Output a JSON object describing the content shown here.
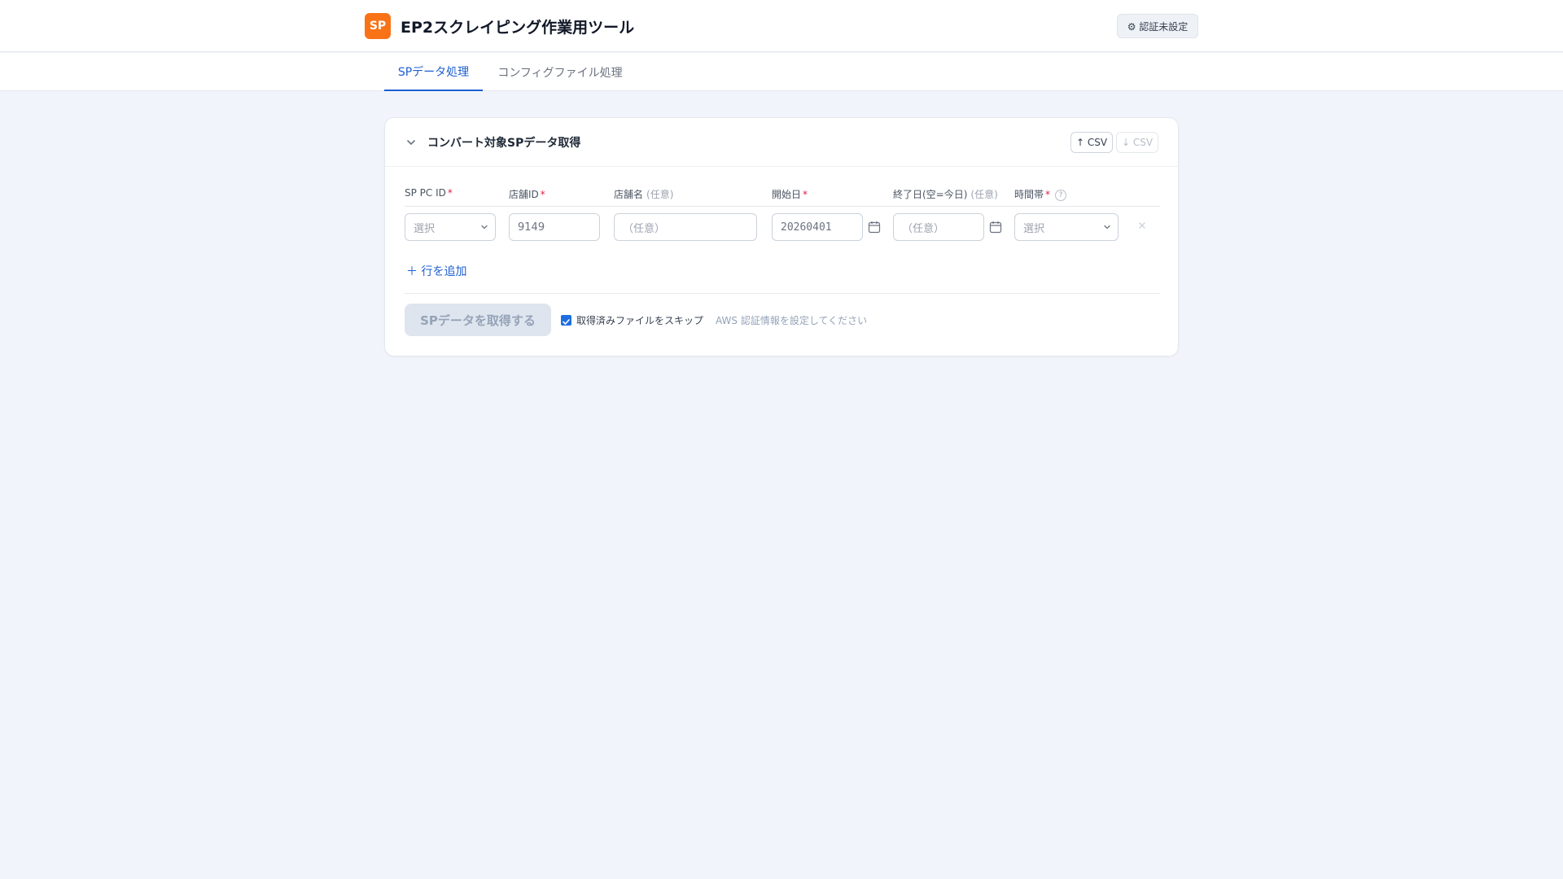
{
  "app": {
    "logo_text": "SP",
    "title": "EP2スクレイピング作業用ツール",
    "auth_button": "⚙ 認証未設定"
  },
  "tabs": [
    {
      "label": "SPデータ処理",
      "active": true
    },
    {
      "label": "コンフィグファイル処理",
      "active": false
    }
  ],
  "card": {
    "title": "コンバート対象SPデータ取得",
    "csv_upload": "↑ CSV",
    "csv_download": "↓ CSV",
    "columns": {
      "sp_pc_id": {
        "label": "SP PC ID",
        "required": "*"
      },
      "store_id": {
        "label": "店舗ID",
        "required": "*"
      },
      "store_name": {
        "label": "店舗名",
        "optional": "(任意)"
      },
      "start_date": {
        "label": "開始日",
        "required": "*"
      },
      "end_date": {
        "label": "終了日(空=今日)",
        "optional": "(任意)"
      },
      "time_slot": {
        "label": "時間帯",
        "required": "*",
        "help": "?"
      }
    },
    "row": {
      "sp_pc_id_select": "選択",
      "store_id_placeholder": "9149",
      "store_name_placeholder": "（任意）",
      "start_date_value": "20260401",
      "end_date_placeholder": "（任意）",
      "time_slot_select": "選択"
    },
    "add_row": "＋ 行を追加",
    "fetch_button": "SPデータを取得する",
    "skip_checkbox": {
      "label": "取得済みファイルをスキップ",
      "checked": true
    },
    "aws_note": "AWS 認証情報を設定してください"
  },
  "colors": {
    "accent": "#1d5fd1",
    "logo": "#f97316",
    "required": "#e11d48"
  }
}
